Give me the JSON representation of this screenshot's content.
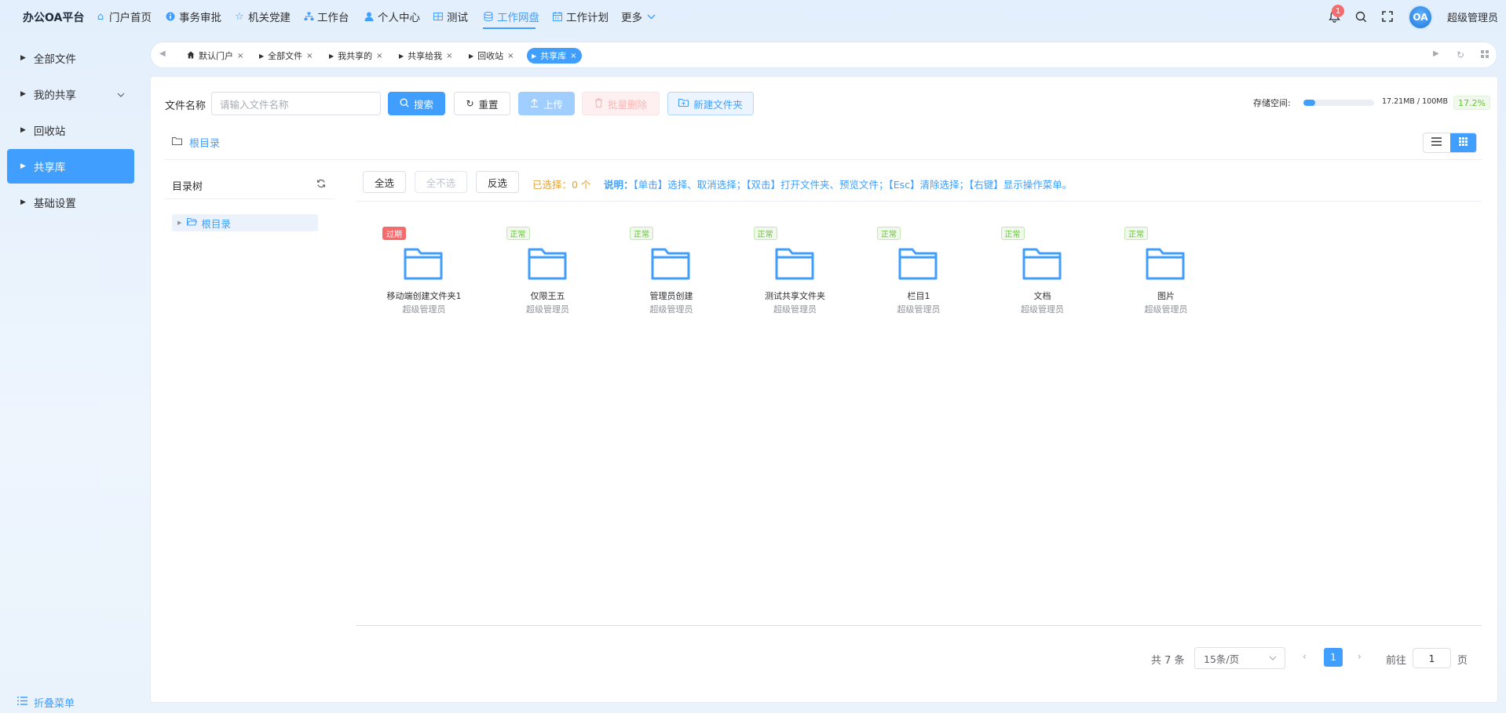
{
  "header": {
    "brand": "办公OA平台",
    "nav": [
      {
        "label": "门户首页",
        "icon": "home-icon"
      },
      {
        "label": "事务审批",
        "icon": "info-icon"
      },
      {
        "label": "机关党建",
        "icon": "star-icon"
      },
      {
        "label": "工作台",
        "icon": "sitemap-icon"
      },
      {
        "label": "个人中心",
        "icon": "user-icon"
      },
      {
        "label": "测试",
        "icon": "grid-icon"
      },
      {
        "label": "工作网盘",
        "icon": "database-icon",
        "active": true
      },
      {
        "label": "工作计划",
        "icon": "calendar-icon"
      },
      {
        "label": "更多",
        "icon": "chevron-down-icon"
      }
    ],
    "notification_count": "1",
    "avatar_text": "OA",
    "username": "超级管理员"
  },
  "sidebar": {
    "items": [
      {
        "label": "全部文件"
      },
      {
        "label": "我的共享"
      },
      {
        "label": "回收站"
      },
      {
        "label": "共享库",
        "active": true
      },
      {
        "label": "基础设置"
      }
    ],
    "collapse_label": "折叠菜单"
  },
  "tabs": [
    {
      "label": "默认门户"
    },
    {
      "label": "全部文件"
    },
    {
      "label": "我共享的"
    },
    {
      "label": "共享给我"
    },
    {
      "label": "回收站"
    },
    {
      "label": "共享库",
      "active": true
    }
  ],
  "toolbar": {
    "filename_label": "文件名称",
    "search_placeholder": "请输入文件名称",
    "search_label": "搜索",
    "reset_label": "重置",
    "upload_label": "上传",
    "batch_delete_label": "批量删除",
    "new_folder_label": "新建文件夹",
    "storage_label": "存储空间:",
    "storage_text": "17.21MB / 100MB",
    "storage_percent": "17.2%",
    "storage_fraction": 0.172
  },
  "breadcrumb": {
    "root": "根目录"
  },
  "tree": {
    "title": "目录树",
    "root": "根目录"
  },
  "selection": {
    "select_all": "全选",
    "select_none": "全不选",
    "invert": "反选",
    "selected_count": "已选择：0 个",
    "note_label": "说明：",
    "note_text": "【单击】选择、取消选择；【双击】打开文件夹、预览文件；【Esc】清除选择；【右键】显示操作菜单。"
  },
  "files": [
    {
      "name": "移动端创建文件夹1",
      "owner": "超级管理员",
      "status": "过期",
      "status_color": "#f56c6c"
    },
    {
      "name": "仅限王五",
      "owner": "超级管理员",
      "status": "正常",
      "status_color": "#67c23a"
    },
    {
      "name": "管理员创建",
      "owner": "超级管理员",
      "status": "正常",
      "status_color": "#67c23a"
    },
    {
      "name": "测试共享文件夹",
      "owner": "超级管理员",
      "status": "正常",
      "status_color": "#67c23a"
    },
    {
      "name": "栏目1",
      "owner": "超级管理员",
      "status": "正常",
      "status_color": "#67c23a"
    },
    {
      "name": "文档",
      "owner": "超级管理员",
      "status": "正常",
      "status_color": "#67c23a"
    },
    {
      "name": "图片",
      "owner": "超级管理员",
      "status": "正常",
      "status_color": "#67c23a"
    }
  ],
  "pagination": {
    "total": "共 7 条",
    "page_size": "15条/页",
    "current_page": "1",
    "goto_label": "前往",
    "goto_value": "1",
    "page_unit": "页"
  },
  "colors": {
    "accent": "#409eff",
    "warning": "#e6a23c",
    "success": "#67c23a",
    "danger": "#f56c6c"
  }
}
